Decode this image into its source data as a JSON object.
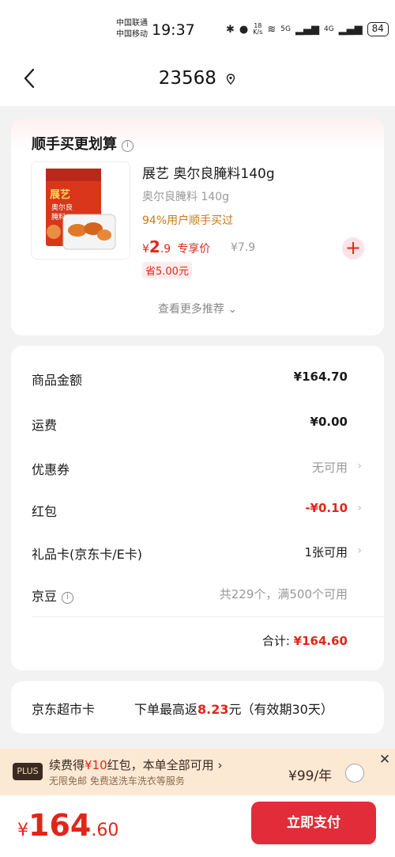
{
  "status_bar": {
    "carrier_1": "中国联通",
    "carrier_2": "中国移动",
    "time": "19:37",
    "speed_value": "18",
    "speed_unit": "K/s",
    "net_1": "5G",
    "net_2": "4G",
    "battery": "84"
  },
  "nav": {
    "title": "23568"
  },
  "upsell": {
    "title": "顺手买更划算",
    "product_name": "展艺 奥尔良腌料140g",
    "spec": "奥尔良腌料 140g",
    "hint": "94%用户顺手买过",
    "price_symbol": "¥",
    "price_int": "2",
    "price_dec": ".9",
    "price_tag": "专享价",
    "original_price": "¥7.9",
    "save_tag": "省5.00元",
    "more_label": "查看更多推荐",
    "package": {
      "brand": "展艺",
      "line1": "奥尔良",
      "line2": "腌料"
    }
  },
  "summary": {
    "rows": [
      {
        "label": "商品金额",
        "value": "¥164.70"
      },
      {
        "label": "运费",
        "value": "¥0.00"
      },
      {
        "label": "优惠券",
        "value": "无可用"
      },
      {
        "label": "红包",
        "value": "-¥0.10"
      },
      {
        "label": "礼品卡(京东卡/E卡)",
        "value": "1张可用"
      },
      {
        "label": "京豆",
        "value": "共229个，满500个可用"
      }
    ],
    "total_label": "合计:",
    "total_value": "¥164.60"
  },
  "supermarket_card": {
    "label": "京东超市卡",
    "text_before": "下单最高返",
    "amount": "8.23",
    "text_after": "元（有效期30天）"
  },
  "plus_bar": {
    "badge": "PLUS",
    "main_before": "续费得",
    "main_amount": "¥10",
    "main_after": "红包，本单全部可用",
    "sub": "无限免邮 免费送洗车洗衣等服务",
    "price": "¥99/年"
  },
  "bottom_bar": {
    "currency": "¥",
    "total_int": "164",
    "total_dec": ".60",
    "pay_label": "立即支付"
  },
  "colors": {
    "accent_red": "#e1251b",
    "pay_button": "#e22c3a",
    "hint_orange": "#c87a16",
    "plus_bg": "#fbe9d4"
  }
}
